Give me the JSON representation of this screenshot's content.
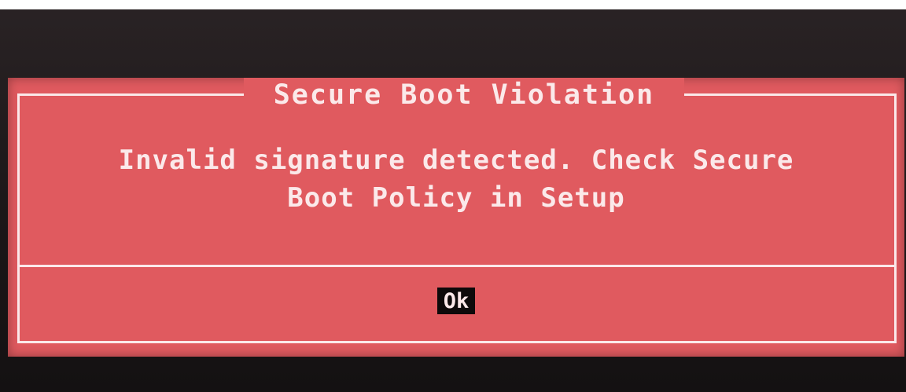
{
  "dialog": {
    "title": "Secure Boot Violation",
    "message_line1": "Invalid signature detected. Check Secure",
    "message_line2": "Boot Policy in Setup",
    "ok_label": "Ok"
  },
  "colors": {
    "dialog_background": "#e05a5f",
    "text": "#fbe9ea",
    "button_background": "#0e0a0b",
    "screen_background": "#1b1718"
  }
}
